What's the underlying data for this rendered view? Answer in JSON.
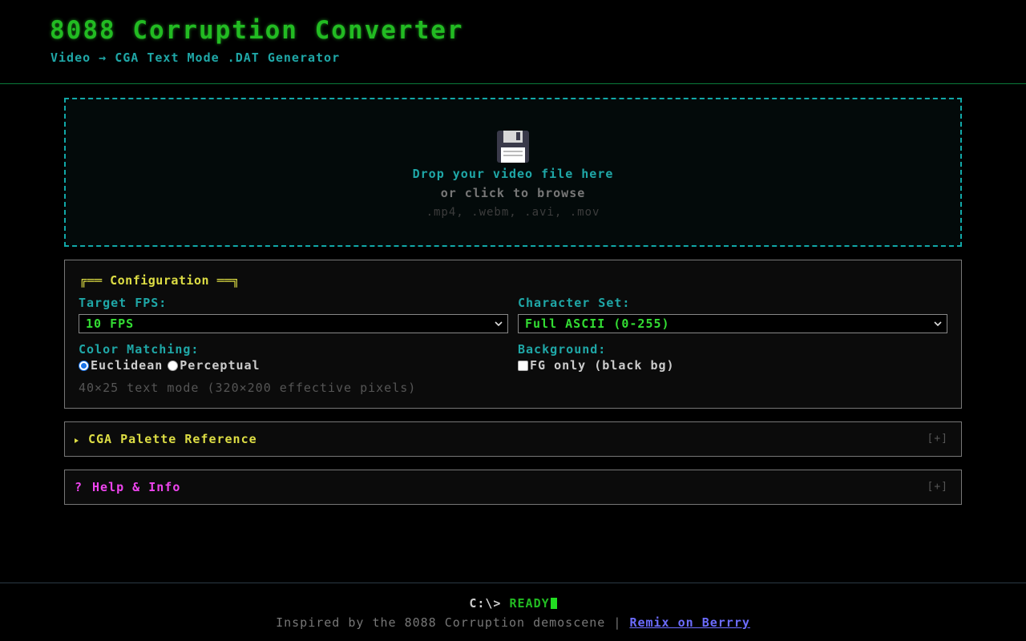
{
  "header": {
    "title": "8088 Corruption Converter",
    "subtitle": "Video → CGA Text Mode .DAT Generator"
  },
  "dropzone": {
    "icon": "floppy-disk-icon",
    "main_text": "Drop your video file here",
    "sub_text": "or click to browse",
    "formats": ".mp4, .webm, .avi, .mov"
  },
  "config": {
    "legend": "Configuration",
    "legend_left": "╔══",
    "legend_right": "══╗",
    "fps_label": "Target FPS:",
    "fps_value": "10 FPS",
    "charset_label": "Character Set:",
    "charset_value": "Full ASCII (0-255)",
    "color_label": "Color Matching:",
    "color_options": [
      "Euclidean",
      "Perceptual"
    ],
    "color_selected": "Euclidean",
    "bg_label": "Background:",
    "bg_option": "FG only (black bg)",
    "bg_checked": false,
    "info": "40×25 text mode (320×200 effective pixels)"
  },
  "palette_panel": {
    "title": "CGA Palette Reference",
    "toggle": "[+]"
  },
  "help_panel": {
    "icon": "?",
    "title": "Help & Info",
    "toggle": "[+]"
  },
  "footer": {
    "prompt_path": "C:\\>",
    "status": "READY",
    "credit_text": "Inspired by the 8088 Corruption demoscene |",
    "link_text": "Remix on Berrry"
  },
  "colors": {
    "background": "#000000",
    "title_green": "#22bb22",
    "cyan": "#1fa7a7",
    "yellow": "#dddd44",
    "magenta": "#ee44ee",
    "link": "#6c6cff"
  }
}
